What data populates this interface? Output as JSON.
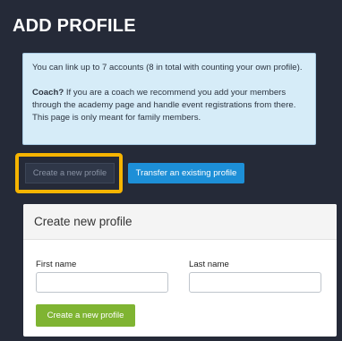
{
  "page": {
    "title": "ADD PROFILE"
  },
  "info": {
    "paragraph1": "You can link up to 7 accounts (8 in total with counting your own profile).",
    "coach_label": "Coach?",
    "coach_text": " If you are a coach we recommend you add your members through the academy page and handle event registrations from there. This page is only meant for family members."
  },
  "tabs": {
    "create_label": "Create a new profile",
    "transfer_label": "Transfer an existing profile"
  },
  "form": {
    "header": "Create new profile",
    "first_name_label": "First name",
    "first_name_value": "",
    "last_name_label": "Last name",
    "last_name_value": "",
    "submit_label": "Create a new profile"
  },
  "colors": {
    "page_background": "#252a38",
    "info_background": "#d6ecf8",
    "highlight": "#f6b400",
    "transfer_button": "#1d8fd7",
    "submit_button": "#7fb432"
  }
}
